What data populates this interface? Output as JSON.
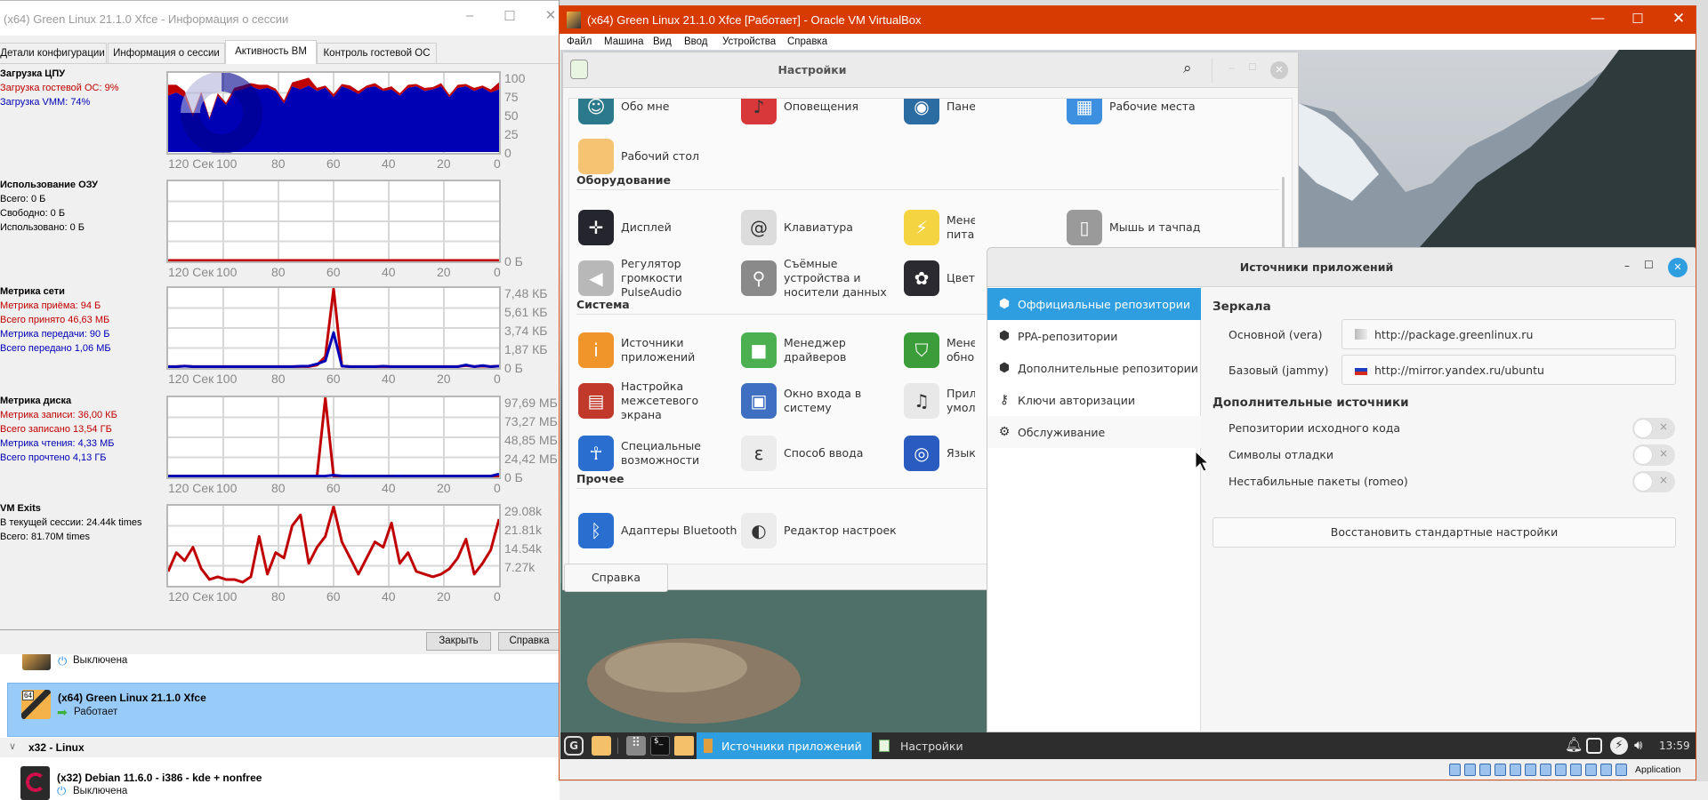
{
  "session_window": {
    "title": "(x64) Green Linux 21.1.0 Xfce - Информация о сессии",
    "tabs": [
      "Детали конфигурации",
      "Информация о сессии",
      "Активность ВМ",
      "Контроль гостевой ОС"
    ],
    "selected_tab": "Активность ВМ",
    "cpu": {
      "title": "Загрузка ЦПУ",
      "guest": "Загрузка гостевой ОС: 9%",
      "vmm": "Загрузка VMM: 74%"
    },
    "ram": {
      "title": "Использование ОЗУ",
      "total": "Всего: 0 Б",
      "free": "Свободно: 0 Б",
      "used": "Использовано: 0 Б"
    },
    "net": {
      "title": "Метрика сети",
      "rx_rate": "Метрика приёма: 94 Б",
      "rx_total": "Всего принято 46,63 МБ",
      "tx_rate": "Метрика передачи: 90 Б",
      "tx_total": "Всего передано 1,06 МБ"
    },
    "disk": {
      "title": "Метрика диска",
      "w_rate": "Метрика записи: 36,00 КБ",
      "w_total": "Всего записано 13,54 ГБ",
      "r_rate": "Метрика чтения: 4,33 МБ",
      "r_total": "Всего прочтено 4,13 ГБ"
    },
    "exits": {
      "title": "VM Exits",
      "session": "В текущей сессии: 24.44k times",
      "total": "Всего: 81.70M times"
    },
    "buttons": {
      "close": "Закрыть",
      "help": "Справка"
    }
  },
  "colors": {
    "red": "#c00000",
    "blue": "#0000b4",
    "accent_orange": "#d83b01",
    "guest_blue": "#2f9ee0"
  },
  "chart_data": [
    {
      "id": "cpu",
      "type": "area",
      "stacked": true,
      "xlim": [
        120,
        0
      ],
      "ylim": [
        0,
        100
      ],
      "x_ticks": [
        "120 Сек",
        "100",
        "80",
        "60",
        "40",
        "20",
        "0"
      ],
      "y_ticks": [
        "0",
        "25",
        "50",
        "75",
        "100"
      ],
      "grid": true,
      "x": [
        120,
        117,
        114,
        111,
        108,
        105,
        102,
        99,
        96,
        93,
        90,
        87,
        84,
        81,
        78,
        75,
        72,
        69,
        66,
        63,
        60,
        57,
        54,
        51,
        48,
        45,
        42,
        39,
        36,
        33,
        30,
        27,
        24,
        21,
        18,
        15,
        12,
        9,
        6,
        3,
        0
      ],
      "series": [
        {
          "name": "Загрузка VMM",
          "color": "#0000b4",
          "values": [
            72,
            76,
            70,
            45,
            74,
            42,
            72,
            60,
            78,
            80,
            84,
            80,
            82,
            78,
            62,
            84,
            80,
            85,
            78,
            82,
            70,
            84,
            80,
            74,
            82,
            84,
            78,
            80,
            72,
            82,
            84,
            78,
            80,
            84,
            70,
            82,
            84,
            78,
            82,
            76,
            80
          ]
        },
        {
          "name": "Загрузка гостевой ОС",
          "color": "#c00000",
          "values": [
            14,
            10,
            8,
            4,
            3,
            2,
            3,
            3,
            4,
            5,
            4,
            6,
            4,
            3,
            4,
            5,
            12,
            10,
            4,
            3,
            4,
            3,
            5,
            4,
            3,
            4,
            3,
            4,
            3,
            4,
            3,
            4,
            3,
            4,
            3,
            4,
            3,
            4,
            3,
            4,
            9
          ]
        }
      ]
    },
    {
      "id": "ram",
      "type": "line",
      "xlim": [
        120,
        0
      ],
      "ylim": [
        0,
        1
      ],
      "x_ticks": [
        "120 Сек",
        "100",
        "80",
        "60",
        "40",
        "20",
        "0"
      ],
      "y_ticks": [
        "0 Б"
      ],
      "grid": true,
      "x": [
        120,
        0
      ],
      "series": [
        {
          "color": "#c00000",
          "values": [
            0,
            0
          ]
        }
      ]
    },
    {
      "id": "net",
      "type": "line",
      "xlim": [
        120,
        0
      ],
      "ylim": [
        0,
        7.48
      ],
      "unit": "КБ",
      "x_ticks": [
        "120 Сек",
        "100",
        "80",
        "60",
        "40",
        "20",
        "0"
      ],
      "y_ticks": [
        "0 Б",
        "1,87 КБ",
        "3,74 КБ",
        "5,61 КБ",
        "7,48 КБ"
      ],
      "grid": true,
      "x": [
        120,
        117,
        114,
        111,
        108,
        105,
        102,
        99,
        96,
        93,
        90,
        87,
        84,
        81,
        78,
        75,
        72,
        69,
        66,
        63,
        60,
        57,
        54,
        51,
        48,
        45,
        42,
        39,
        36,
        33,
        30,
        27,
        24,
        21,
        18,
        15,
        12,
        9,
        6,
        3,
        0
      ],
      "series": [
        {
          "name": "Метрика приёма",
          "color": "#c00000",
          "values": [
            0.05,
            0.05,
            0.1,
            0.05,
            0.05,
            0.05,
            0.05,
            0.05,
            0.05,
            0.05,
            0.05,
            0.05,
            0.05,
            0.05,
            0.05,
            0.05,
            0.05,
            0.05,
            0.2,
            1.0,
            7.48,
            0.1,
            0.05,
            0.05,
            0.05,
            0.05,
            0.05,
            0.05,
            0.05,
            0.05,
            0.05,
            0.05,
            0.05,
            0.05,
            0.05,
            0.05,
            0.15,
            0.05,
            0.1,
            0.05,
            0.1
          ]
        },
        {
          "name": "Метрика передачи",
          "color": "#0000b4",
          "values": [
            0.04,
            0.04,
            0.1,
            0.04,
            0.04,
            0.04,
            0.04,
            0.04,
            0.04,
            0.04,
            0.04,
            0.04,
            0.04,
            0.04,
            0.04,
            0.04,
            0.08,
            0.1,
            0.3,
            0.6,
            3.3,
            0.1,
            0.04,
            0.04,
            0.04,
            0.04,
            0.08,
            0.04,
            0.04,
            0.04,
            0.04,
            0.04,
            0.04,
            0.04,
            0.04,
            0.04,
            0.2,
            0.04,
            0.15,
            0.04,
            0.1
          ]
        }
      ]
    },
    {
      "id": "disk",
      "type": "line",
      "xlim": [
        120,
        0
      ],
      "ylim": [
        0,
        97.69
      ],
      "unit": "МБ",
      "x_ticks": [
        "120 Сек",
        "100",
        "80",
        "60",
        "40",
        "20",
        "0"
      ],
      "y_ticks": [
        "0 Б",
        "24,42 МБ",
        "48,85 МБ",
        "73,27 МБ",
        "97,69 МБ"
      ],
      "grid": true,
      "x": [
        120,
        117,
        114,
        111,
        108,
        105,
        102,
        99,
        96,
        93,
        90,
        87,
        84,
        81,
        78,
        75,
        72,
        69,
        66,
        63,
        60,
        57,
        54,
        51,
        48,
        45,
        42,
        39,
        36,
        33,
        30,
        27,
        24,
        21,
        18,
        15,
        12,
        9,
        6,
        3,
        0
      ],
      "series": [
        {
          "name": "Метрика записи",
          "color": "#c00000",
          "values": [
            0.5,
            0.5,
            0.5,
            0.5,
            0.5,
            0.5,
            0.5,
            0.5,
            0.5,
            0.5,
            0.5,
            0.5,
            0.5,
            0.5,
            0.5,
            0.5,
            0.5,
            0.5,
            0.5,
            97.69,
            0.5,
            0.5,
            0.5,
            0.5,
            0.5,
            0.5,
            0.5,
            0.5,
            0.5,
            0.5,
            0.5,
            0.5,
            0.5,
            0.5,
            0.5,
            0.5,
            0.5,
            0.5,
            0.5,
            0.5,
            0.5
          ]
        },
        {
          "name": "Метрика чтения",
          "color": "#0000b4",
          "values": [
            0.4,
            0.4,
            0.4,
            0.4,
            0.4,
            0.4,
            0.4,
            0.4,
            0.4,
            0.4,
            0.4,
            0.4,
            0.4,
            0.4,
            0.4,
            0.4,
            0.4,
            0.4,
            0.4,
            0.6,
            1.5,
            0.6,
            0.6,
            0.4,
            0.4,
            0.4,
            0.4,
            0.4,
            0.6,
            0.4,
            0.4,
            0.4,
            0.4,
            0.4,
            0.4,
            0.4,
            0.4,
            0.4,
            0.4,
            0.4,
            3.0
          ]
        }
      ]
    },
    {
      "id": "exits",
      "type": "line",
      "xlim": [
        120,
        0
      ],
      "ylim": [
        0,
        29.08
      ],
      "unit": "k",
      "x_ticks": [
        "120 Сек",
        "100",
        "80",
        "60",
        "40",
        "20",
        "0"
      ],
      "y_ticks": [
        "7.27k",
        "14.54k",
        "21.81k",
        "29.08k"
      ],
      "grid": true,
      "x": [
        120,
        117,
        114,
        111,
        108,
        105,
        102,
        99,
        96,
        93,
        90,
        87,
        84,
        81,
        78,
        75,
        72,
        69,
        66,
        63,
        60,
        57,
        54,
        51,
        48,
        45,
        42,
        39,
        36,
        33,
        30,
        27,
        24,
        21,
        18,
        15,
        12,
        9,
        6,
        3,
        0
      ],
      "series": [
        {
          "name": "VM Exits",
          "color": "#c00000",
          "values": [
            5,
            12,
            9,
            14,
            6,
            2,
            3,
            2,
            2,
            1,
            3,
            18,
            4,
            12,
            10,
            22,
            26,
            8,
            14,
            18,
            29.08,
            16,
            10,
            4,
            10,
            16,
            14,
            23,
            8,
            12,
            5,
            4,
            3,
            4,
            6,
            10,
            17,
            4,
            8,
            13,
            24.44
          ]
        }
      ]
    }
  ],
  "vm_list": {
    "items": [
      {
        "name": "",
        "status": "Выключена"
      },
      {
        "name": "(x64) Green Linux 21.1.0 Xfce",
        "status": "Работает",
        "badge": "64"
      },
      {
        "name": "(x32) Debian 11.6.0 - i386 - kde + nonfree",
        "status": "Выключена"
      }
    ],
    "group": "x32 - Linux"
  },
  "vbox": {
    "title": "(x64) Green Linux 21.1.0 Xfce [Работает] - Oracle VM VirtualBox",
    "menu": [
      "Файл",
      "Машина",
      "Вид",
      "Ввод",
      "Устройства",
      "Справка"
    ],
    "status_text": "Application"
  },
  "settings": {
    "title": "Настройки",
    "help": "Справка",
    "sections": [
      {
        "title": "",
        "rows": [
          [
            {
              "label": "Обо мне",
              "icon": "user-icon",
              "color": "#2b7a8c",
              "glyph": "☺"
            },
            {
              "label": "Оповещения",
              "icon": "bell-icon",
              "color": "#d8383a",
              "glyph": "♪"
            },
            {
              "label": "Панель",
              "icon": "panel-icon",
              "color": "#2b6ca3",
              "glyph": "◉"
            },
            {
              "label": "Рабочие места",
              "icon": "workspaces-icon",
              "color": "#3d8fe0",
              "glyph": "▦"
            }
          ],
          [
            {
              "label": "Рабочий стол",
              "icon": "desktop-icon",
              "color": "#f5c472",
              "glyph": ""
            }
          ]
        ]
      },
      {
        "title": "Оборудование",
        "rows": [
          [
            {
              "label": "Дисплей",
              "icon": "display-icon",
              "color": "#25252d",
              "glyph": "✛"
            },
            {
              "label": "Клавиатура",
              "icon": "keyboard-icon",
              "color": "#dcdcdc",
              "glyph": "@"
            },
            {
              "label": "Менеджер питания",
              "icon": "power-icon",
              "color": "#f5d442",
              "glyph": "⚡"
            },
            {
              "label": "Мышь и тачпад",
              "icon": "mouse-icon",
              "color": "#9a9a9a",
              "glyph": "▯"
            }
          ],
          [
            {
              "label": "Регулятор\nгромкости\nPulseAudio",
              "icon": "volume-icon",
              "color": "#b8b8b8",
              "glyph": "◀"
            },
            {
              "label": "Съёмные\nустройства и\nносители данных",
              "icon": "usb-icon",
              "color": "#8a8a8a",
              "glyph": "⚲"
            },
            {
              "label": "Цветов",
              "icon": "color-icon",
              "color": "#2a2a30",
              "glyph": "✿"
            }
          ]
        ]
      },
      {
        "title": "Система",
        "rows": [
          [
            {
              "label": "Источники\nприложений",
              "icon": "info-icon",
              "color": "#f0952a",
              "glyph": "i"
            },
            {
              "label": "Менеджер\nдрайверов",
              "icon": "chip-icon",
              "color": "#4caf50",
              "glyph": "■"
            },
            {
              "label": "Менедж\nобновл",
              "icon": "shield-icon",
              "color": "#3a9d3a",
              "glyph": "⛉"
            }
          ],
          [
            {
              "label": "Настройка\nмежсетевого\nэкрана",
              "icon": "firewall-icon",
              "color": "#c0392b",
              "glyph": "▤"
            },
            {
              "label": "Окно входа в\nсистему",
              "icon": "login-icon",
              "color": "#3f6fc0",
              "glyph": "▣"
            },
            {
              "label": "Прилож\nумолча",
              "icon": "default-apps-icon",
              "color": "#e8e8e8",
              "glyph": "♫"
            }
          ],
          [
            {
              "label": "Специальные\nвозможности",
              "icon": "accessibility-icon",
              "color": "#2a6fd0",
              "glyph": "☥"
            },
            {
              "label": "Способ ввода",
              "icon": "input-method-icon",
              "color": "#ececec",
              "glyph": "ε"
            },
            {
              "label": "Языки",
              "icon": "globe-icon",
              "color": "#2a5cc0",
              "glyph": "◎"
            }
          ]
        ]
      },
      {
        "title": "Прочее",
        "rows": [
          [
            {
              "label": "Адаптеры Bluetooth",
              "icon": "bluetooth-icon",
              "color": "#2a6fd0",
              "glyph": "ᛒ"
            },
            {
              "label": "Редактор настроек",
              "icon": "toggles-icon",
              "color": "#ececec",
              "glyph": "◐"
            }
          ]
        ]
      }
    ]
  },
  "sources_dialog": {
    "title": "Источники приложений",
    "sidebar": [
      {
        "label": "Оффициальные репозитории",
        "icon": "package-icon",
        "glyph": "⬢",
        "selected": true
      },
      {
        "label": "PPA-репозитории",
        "icon": "package-icon",
        "glyph": "⬢"
      },
      {
        "label": "Дополнительные репозитории",
        "icon": "package-icon",
        "glyph": "⬢"
      },
      {
        "label": "Ключи авторизации",
        "icon": "key-icon",
        "glyph": "⚷"
      },
      {
        "label": "Обслуживание",
        "icon": "gear-icon",
        "glyph": "⚙"
      }
    ],
    "mirrors_title": "Зеркала",
    "main_label": "Основной (vera)",
    "main_url": "http://package.greenlinux.ru",
    "base_label": "Базовый (jammy)",
    "base_url": "http://mirror.yandex.ru/ubuntu",
    "extra_title": "Дополнительные источники",
    "toggles": [
      {
        "label": "Репозитории исходного кода",
        "on": false
      },
      {
        "label": "Символы отладки",
        "on": false
      },
      {
        "label": "Нестабильные пакеты (romeo)",
        "on": false
      }
    ],
    "restore": "Восстановить стандартные настройки"
  },
  "taskbar": {
    "active": "Источники приложений",
    "other": "Настройки",
    "clock": "13:59"
  }
}
